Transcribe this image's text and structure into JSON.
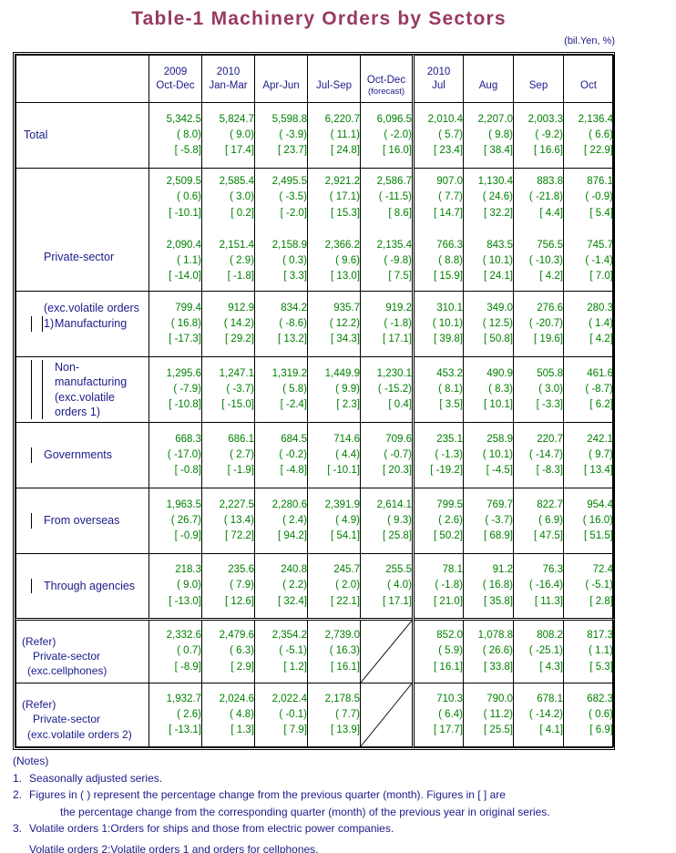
{
  "title": "Table-1  Machinery  Orders  by  Sectors",
  "unit": "(bil.Yen, %)",
  "colors": {
    "title": "#973a62",
    "header_text": "#1b1b8a",
    "value_text": "#008000"
  },
  "header": {
    "corner": "",
    "quarters": [
      {
        "year": "2009",
        "period": "Oct-Dec",
        "sub": ""
      },
      {
        "year": "2010",
        "period": "Jan-Mar",
        "sub": ""
      },
      {
        "year": "",
        "period": "Apr-Jun",
        "sub": ""
      },
      {
        "year": "",
        "period": "Jul-Sep",
        "sub": ""
      },
      {
        "year": "",
        "period": "Oct-Dec",
        "sub": "(forecast)"
      }
    ],
    "months": [
      {
        "year": "2010",
        "period": "Jul",
        "sub": ""
      },
      {
        "year": "",
        "period": "Aug",
        "sub": ""
      },
      {
        "year": "",
        "period": "Sep",
        "sub": ""
      },
      {
        "year": "",
        "period": "Oct",
        "sub": ""
      }
    ]
  },
  "rows": [
    {
      "label1": "Total",
      "label2": "",
      "indent": 0,
      "cells": [
        {
          "v": "5,342.5",
          "p": "(  8.0)",
          "b": "[ -5.8]"
        },
        {
          "v": "5,824.7",
          "p": "(  9.0)",
          "b": "[ 17.4]"
        },
        {
          "v": "5,598.8",
          "p": "( -3.9)",
          "b": "[ 23.7]"
        },
        {
          "v": "6,220.7",
          "p": "( 11.1)",
          "b": "[ 24.8]"
        },
        {
          "v": "6,096.5",
          "p": "( -2.0)",
          "b": "[ 16.0]"
        },
        {
          "v": "2,010.4",
          "p": "(  5.7)",
          "b": "[ 23.4]"
        },
        {
          "v": "2,207.0",
          "p": "(  9.8)",
          "b": "[ 38.4]"
        },
        {
          "v": "2,003.3",
          "p": "( -9.2)",
          "b": "[ 16.6]"
        },
        {
          "v": "2,136.4",
          "p": "(  6.6)",
          "b": "[ 22.9]"
        }
      ]
    },
    {
      "label1": "Private-sector",
      "label2": "(exc.volatile orders 1)",
      "indent": 1,
      "double": true,
      "cells": [
        {
          "v": "2,509.5",
          "p": "(  0.6)",
          "b": "[ -10.1]"
        },
        {
          "v": "2,585.4",
          "p": "(  3.0)",
          "b": "[  0.2]"
        },
        {
          "v": "2,495.5",
          "p": "( -3.5)",
          "b": "[ -2.0]"
        },
        {
          "v": "2,921.2",
          "p": "( 17.1)",
          "b": "[ 15.3]"
        },
        {
          "v": "2,586.7",
          "p": "( -11.5)",
          "b": "[  8.6]"
        },
        {
          "v": "907.0",
          "p": "(  7.7)",
          "b": "[ 14.7]"
        },
        {
          "v": "1,130.4",
          "p": "( 24.6)",
          "b": "[ 32.2]"
        },
        {
          "v": "883.8",
          "p": "( -21.8)",
          "b": "[  4.4]"
        },
        {
          "v": "876.1",
          "p": "( -0.9)",
          "b": "[  5.4]"
        }
      ],
      "cells2": [
        {
          "v": "2,090.4",
          "p": "(  1.1)",
          "b": "[ -14.0]"
        },
        {
          "v": "2,151.4",
          "p": "(  2.9)",
          "b": "[ -1.8]"
        },
        {
          "v": "2,158.9",
          "p": "(  0.3)",
          "b": "[  3.3]"
        },
        {
          "v": "2,366.2",
          "p": "(  9.6)",
          "b": "[ 13.0]"
        },
        {
          "v": "2,135.4",
          "p": "( -9.8)",
          "b": "[  7.5]"
        },
        {
          "v": "766.3",
          "p": "(  8.8)",
          "b": "[ 15.9]"
        },
        {
          "v": "843.5",
          "p": "( 10.1)",
          "b": "[ 24.1]"
        },
        {
          "v": "756.5",
          "p": "( -10.3)",
          "b": "[  4.2]"
        },
        {
          "v": "745.7",
          "p": "( -1.4)",
          "b": "[  7.0]"
        }
      ]
    },
    {
      "label1": "Manufacturing",
      "label2": "",
      "indent": 2,
      "cells": [
        {
          "v": "799.4",
          "p": "( 16.8)",
          "b": "[ -17.3]"
        },
        {
          "v": "912.9",
          "p": "( 14.2)",
          "b": "[ 29.2]"
        },
        {
          "v": "834.2",
          "p": "( -8.6)",
          "b": "[ 13.2]"
        },
        {
          "v": "935.7",
          "p": "( 12.2)",
          "b": "[ 34.3]"
        },
        {
          "v": "919.2",
          "p": "( -1.8)",
          "b": "[ 17.1]"
        },
        {
          "v": "310.1",
          "p": "( 10.1)",
          "b": "[ 39.8]"
        },
        {
          "v": "349.0",
          "p": "( 12.5)",
          "b": "[ 50.8]"
        },
        {
          "v": "276.6",
          "p": "( -20.7)",
          "b": "[ 19.6]"
        },
        {
          "v": "280.3",
          "p": "(  1.4)",
          "b": "[  4.2]"
        }
      ]
    },
    {
      "label1": "Non-manufacturing",
      "label2": "(exc.volatile orders 1)",
      "indent": 2,
      "cells": [
        {
          "v": "1,295.6",
          "p": "( -7.9)",
          "b": "[ -10.8]"
        },
        {
          "v": "1,247.1",
          "p": "( -3.7)",
          "b": "[ -15.0]"
        },
        {
          "v": "1,319.2",
          "p": "(  5.8)",
          "b": "[ -2.4]"
        },
        {
          "v": "1,449.9",
          "p": "(  9.9)",
          "b": "[  2.3]"
        },
        {
          "v": "1,230.1",
          "p": "( -15.2)",
          "b": "[  0.4]"
        },
        {
          "v": "453.2",
          "p": "(  8.1)",
          "b": "[  3.5]"
        },
        {
          "v": "490.9",
          "p": "(  8.3)",
          "b": "[ 10.1]"
        },
        {
          "v": "505.8",
          "p": "(  3.0)",
          "b": "[ -3.3]"
        },
        {
          "v": "461.6",
          "p": "( -8.7)",
          "b": "[  6.2]"
        }
      ]
    },
    {
      "label1": "Governments",
      "label2": "",
      "indent": 1,
      "cells": [
        {
          "v": "668.3",
          "p": "( -17.0)",
          "b": "[ -0.8]"
        },
        {
          "v": "686.1",
          "p": "(  2.7)",
          "b": "[ -1.9]"
        },
        {
          "v": "684.5",
          "p": "( -0.2)",
          "b": "[ -4.8]"
        },
        {
          "v": "714.6",
          "p": "(  4.4)",
          "b": "[ -10.1]"
        },
        {
          "v": "709.6",
          "p": "( -0.7)",
          "b": "[ 20.3]"
        },
        {
          "v": "235.1",
          "p": "( -1.3)",
          "b": "[ -19.2]"
        },
        {
          "v": "258.9",
          "p": "( 10.1)",
          "b": "[ -4.5]"
        },
        {
          "v": "220.7",
          "p": "( -14.7)",
          "b": "[ -8.3]"
        },
        {
          "v": "242.1",
          "p": "(  9.7)",
          "b": "[ 13.4]"
        }
      ]
    },
    {
      "label1": "From overseas",
      "label2": "",
      "indent": 1,
      "cells": [
        {
          "v": "1,963.5",
          "p": "( 26.7)",
          "b": "[ -0.9]"
        },
        {
          "v": "2,227.5",
          "p": "( 13.4)",
          "b": "[ 72.2]"
        },
        {
          "v": "2,280.6",
          "p": "(  2.4)",
          "b": "[ 94.2]"
        },
        {
          "v": "2,391.9",
          "p": "(  4.9)",
          "b": "[ 54.1]"
        },
        {
          "v": "2,614.1",
          "p": "(  9.3)",
          "b": "[ 25.8]"
        },
        {
          "v": "799.5",
          "p": "(  2.6)",
          "b": "[ 50.2]"
        },
        {
          "v": "769.7",
          "p": "( -3.7)",
          "b": "[ 68.9]"
        },
        {
          "v": "822.7",
          "p": "(  6.9)",
          "b": "[ 47.5]"
        },
        {
          "v": "954.4",
          "p": "( 16.0)",
          "b": "[ 51.5]"
        }
      ]
    },
    {
      "label1": "Through agencies",
      "label2": "",
      "indent": 1,
      "cells": [
        {
          "v": "218.3",
          "p": "(  9.0)",
          "b": "[ -13.0]"
        },
        {
          "v": "235.6",
          "p": "(  7.9)",
          "b": "[ 12.6]"
        },
        {
          "v": "240.8",
          "p": "(  2.2)",
          "b": "[ 32.4]"
        },
        {
          "v": "245.7",
          "p": "(  2.0)",
          "b": "[ 22.1]"
        },
        {
          "v": "255.5",
          "p": "(  4.0)",
          "b": "[ 17.1]"
        },
        {
          "v": "78.1",
          "p": "( -1.8)",
          "b": "[ 21.0]"
        },
        {
          "v": "91.2",
          "p": "( 16.8)",
          "b": "[ 35.8]"
        },
        {
          "v": "76.3",
          "p": "( -16.4)",
          "b": "[ 11.3]"
        },
        {
          "v": "72.4",
          "p": "( -5.1)",
          "b": "[  2.8]"
        }
      ]
    },
    {
      "refer": true,
      "label1": "(Refer)",
      "label2": "Private-sector",
      "label3": "(exc.cellphones)",
      "cells": [
        {
          "v": "2,332.6",
          "p": "(  0.7)",
          "b": "[ -8.9]"
        },
        {
          "v": "2,479.6",
          "p": "(  6.3)",
          "b": "[  2.9]"
        },
        {
          "v": "2,354.2",
          "p": "( -5.1)",
          "b": "[  1.2]"
        },
        {
          "v": "2,739.0",
          "p": "( 16.3)",
          "b": "[ 16.1]"
        },
        {
          "diagonal": true
        },
        {
          "v": "852.0",
          "p": "(  5.9)",
          "b": "[ 16.1]"
        },
        {
          "v": "1,078.8",
          "p": "( 26.6)",
          "b": "[ 33.8]"
        },
        {
          "v": "808.2",
          "p": "( -25.1)",
          "b": "[  4.3]"
        },
        {
          "v": "817.3",
          "p": "(  1.1)",
          "b": "[  5.3]"
        }
      ]
    },
    {
      "refer": true,
      "label1": "(Refer)",
      "label2": "Private-sector",
      "label3": "(exc.volatile orders 2)",
      "cells": [
        {
          "v": "1,932.7",
          "p": "(  2.6)",
          "b": "[ -13.1]"
        },
        {
          "v": "2,024.6",
          "p": "(  4.8)",
          "b": "[  1.3]"
        },
        {
          "v": "2,022.4",
          "p": "( -0.1)",
          "b": "[  7.9]"
        },
        {
          "v": "2,178.5",
          "p": "(  7.7)",
          "b": "[ 13.9]"
        },
        {
          "diagonal": true
        },
        {
          "v": "710.3",
          "p": "(  6.4)",
          "b": "[ 17.7]"
        },
        {
          "v": "790.0",
          "p": "( 11.2)",
          "b": "[ 25.5]"
        },
        {
          "v": "678.1",
          "p": "( -14.2)",
          "b": "[  4.1]"
        },
        {
          "v": "682.3",
          "p": "(  0.6)",
          "b": "[  6.9]"
        }
      ]
    }
  ],
  "notes": {
    "header": "(Notes)",
    "items": [
      {
        "n": "1.",
        "text": "Seasonally adjusted series.",
        "cont": ""
      },
      {
        "n": "2.",
        "text": "Figures in ( ) represent the percentage change from the previous quarter (month). Figures in [ ] are",
        "cont": "the percentage change from the corresponding quarter (month) of the previous year in original series."
      },
      {
        "n": "3.",
        "text": "Volatile orders 1:Orders for ships and those from electric power companies.",
        "cont": ""
      }
    ],
    "extra": "Volatile orders 2:Volatile orders 1 and orders for cellphones."
  }
}
